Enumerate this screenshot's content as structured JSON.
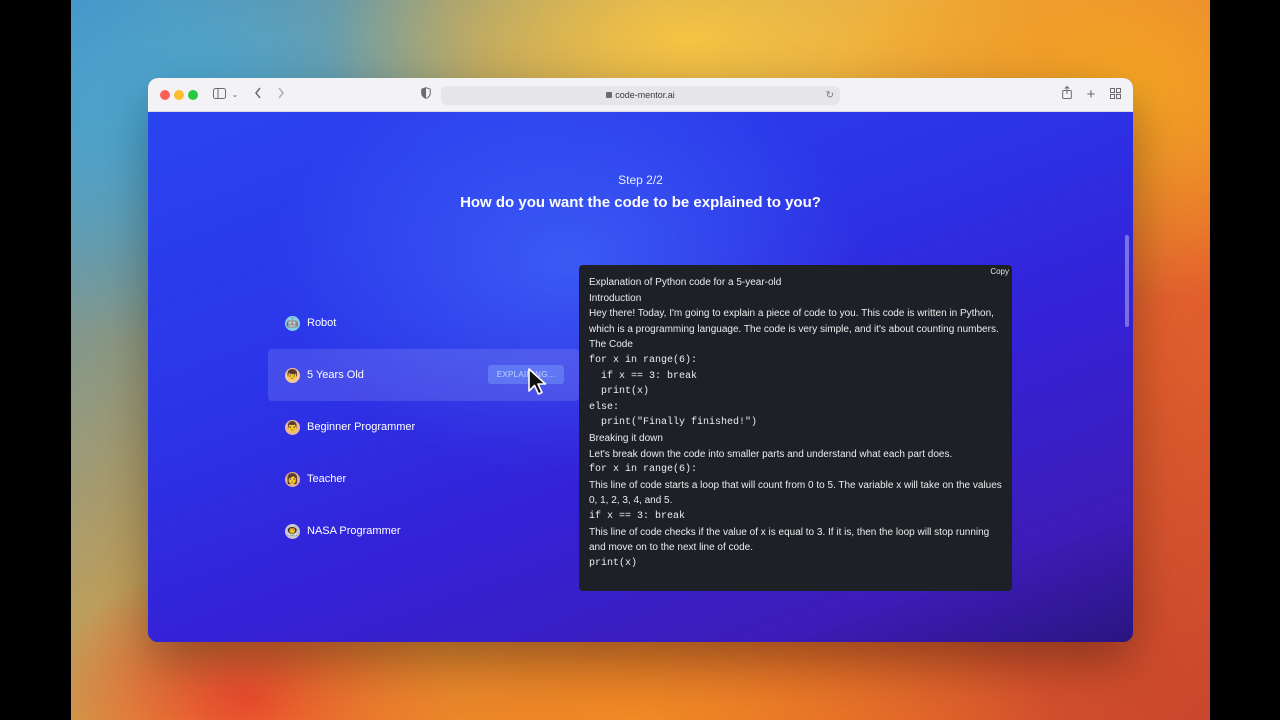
{
  "browser": {
    "url": "code-mentor.ai"
  },
  "page": {
    "step": "Step 2/2",
    "heading": "How do you want the code to be explained to you?"
  },
  "options": [
    {
      "label": "Robot",
      "emoji": "🤖"
    },
    {
      "label": "5 Years Old",
      "emoji": "👦",
      "badge": "EXPLAINING..."
    },
    {
      "label": "Beginner Programmer",
      "emoji": "👨"
    },
    {
      "label": "Teacher",
      "emoji": "👩"
    },
    {
      "label": "NASA Programmer",
      "emoji": "👨‍🚀"
    }
  ],
  "panel": {
    "copy_label": "Copy",
    "lines": [
      "Explanation of Python code for a 5-year-old",
      "Introduction",
      "Hey there! Today, I'm going to explain a piece of code to you. This code is written in Python, which is a programming language. The code is very simple, and it's about counting numbers.",
      "The Code",
      "for x in range(6):",
      "  if x == 3: break",
      "  print(x)",
      "else:",
      "  print(\"Finally finished!\")",
      "Breaking it down",
      "Let's break down the code into smaller parts and understand what each part does.",
      "for x in range(6):",
      "This line of code starts a loop that will count from 0 to 5. The variable x will take on the values 0, 1, 2, 3, 4, and 5.",
      "if x == 3: break",
      "This line of code checks if the value of x is equal to 3. If it is, then the loop will stop running and move on to the next line of code.",
      "print(x)"
    ]
  },
  "colors": {
    "page_top": "#2a44f0",
    "page_bottom": "#3c1cb8",
    "panel_bg": "#1d2026"
  }
}
